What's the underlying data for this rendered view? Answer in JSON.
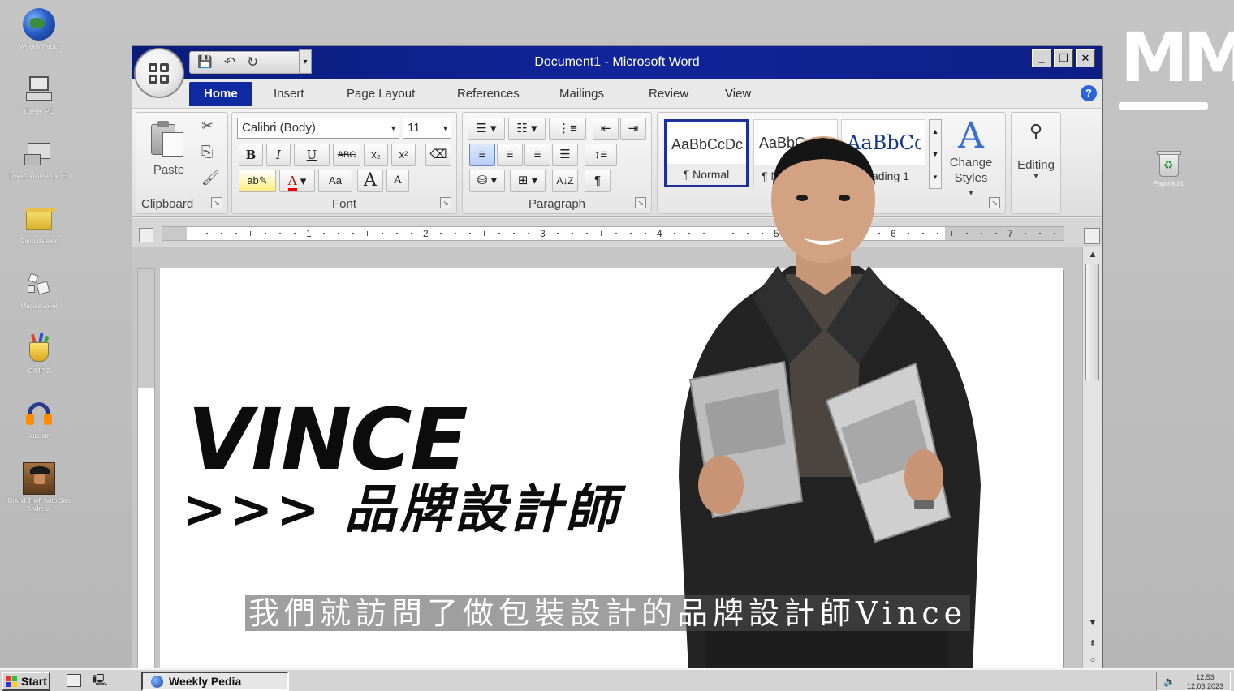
{
  "desktop": {
    "icons": [
      {
        "label": "Weekly Pedia",
        "icon": "globe-icon"
      },
      {
        "label": "Dieser PC",
        "icon": "computer-icon"
      },
      {
        "label": "Diskettenlaufwerk (E:)",
        "icon": "floppy-drive-icon"
      },
      {
        "label": "Gimp dateien",
        "icon": "folder-icon"
      },
      {
        "label": "MagicaVoxel",
        "icon": "cubes-icon"
      },
      {
        "label": "GIMP 2",
        "icon": "gimp-icon"
      },
      {
        "label": "Audacity",
        "icon": "headphones-icon"
      },
      {
        "label": "Grand Theft Auto San Andreas",
        "icon": "gta-icon"
      }
    ],
    "recycle_bin": {
      "label": "Papierkorb"
    },
    "logo": {
      "text": "MM"
    }
  },
  "window": {
    "title": "Document1 - Microsoft Word",
    "buttons": {
      "minimize": "_",
      "restore": "❐",
      "close": "✕"
    },
    "qat": {
      "save": "💾",
      "undo": "↶",
      "redo": "↻",
      "customize": "▾"
    }
  },
  "tabs": [
    "Home",
    "Insert",
    "Page Layout",
    "References",
    "Mailings",
    "Review",
    "View"
  ],
  "active_tab": "Home",
  "help": "?",
  "ribbon": {
    "clipboard": {
      "label": "Clipboard",
      "paste": "Paste"
    },
    "font": {
      "label": "Font",
      "family": "Calibri (Body)",
      "size": "11",
      "bold": "B",
      "italic": "I",
      "underline": "U",
      "strike": "ABC",
      "subscript": "x₂",
      "superscript": "x²",
      "change_case": "Aa",
      "grow": "A",
      "shrink": "A"
    },
    "paragraph": {
      "label": "Paragraph"
    },
    "styles": {
      "items": [
        {
          "sample": "AaBbCcDc",
          "name": "¶ Normal"
        },
        {
          "sample": "AaBbCcDc",
          "name": "¶ No Spacing"
        },
        {
          "sample": "AaBbCc",
          "name": "Heading 1"
        }
      ],
      "change_styles": "Change Styles"
    },
    "editing": {
      "label": "Editing"
    }
  },
  "ruler": {
    "numbers": [
      "1",
      "2",
      "3",
      "4",
      "5",
      "6",
      "7"
    ]
  },
  "document": {
    "headline": "VINCE",
    "subline": ">>> 品牌設計師"
  },
  "subtitle": "我們就訪問了做包裝設計的品牌設計師Vince",
  "taskbar": {
    "start": "Start",
    "task": "Weekly Pedia",
    "time": "12:53",
    "date": "12.03.2023"
  },
  "colors": {
    "titlebar": "#0d1f86",
    "active_tab": "#0f2aa0",
    "desktop": "#c0c0c0"
  }
}
